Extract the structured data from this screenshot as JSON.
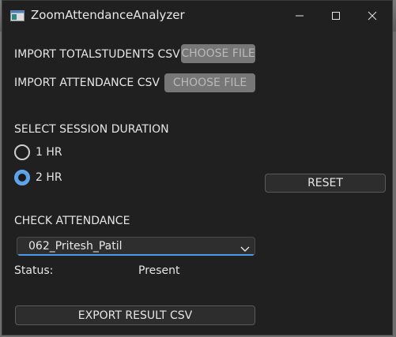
{
  "window": {
    "title": "ZoomAttendanceAnalyzer",
    "app_icon": "window-app-icon",
    "controls": {
      "minimize": "minimize-icon",
      "maximize": "maximize-icon",
      "close": "close-icon"
    }
  },
  "import": {
    "total_students_label": "IMPORT TOTALSTUDENTS CSV",
    "total_students_button": "CHOOSE FILE",
    "attendance_label": "IMPORT ATTENDANCE CSV",
    "attendance_button": "CHOOSE FILE"
  },
  "session": {
    "heading": "SELECT SESSION DURATION",
    "options": [
      {
        "label": "1 HR",
        "selected": false
      },
      {
        "label": "2 HR",
        "selected": true
      }
    ],
    "reset_button": "RESET"
  },
  "attendance": {
    "heading": "CHECK ATTENDANCE",
    "selected_student": "062_Pritesh_Patil",
    "status_label": "Status:",
    "status_value": "Present"
  },
  "export": {
    "button": "EXPORT RESULT CSV"
  },
  "colors": {
    "accent": "#5aa1ea",
    "window_bg": "#202020",
    "disabled_button": "#777777"
  }
}
